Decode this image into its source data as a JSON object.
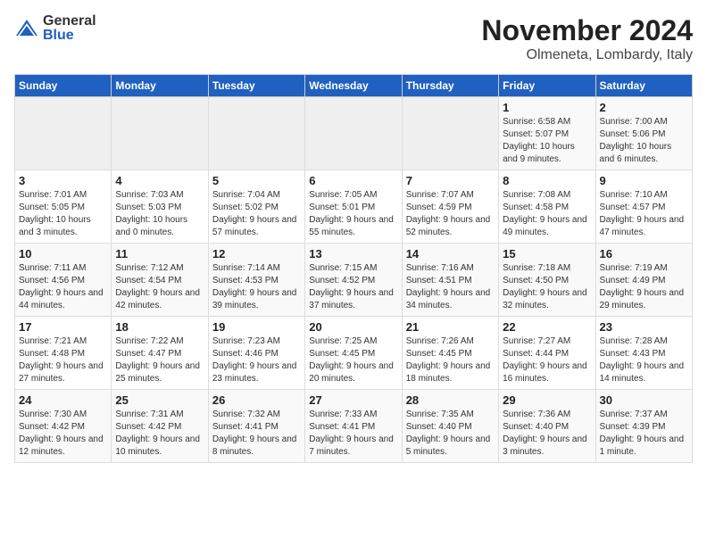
{
  "logo": {
    "general": "General",
    "blue": "Blue"
  },
  "title": "November 2024",
  "subtitle": "Olmeneta, Lombardy, Italy",
  "days_header": [
    "Sunday",
    "Monday",
    "Tuesday",
    "Wednesday",
    "Thursday",
    "Friday",
    "Saturday"
  ],
  "weeks": [
    [
      {
        "day": "",
        "info": ""
      },
      {
        "day": "",
        "info": ""
      },
      {
        "day": "",
        "info": ""
      },
      {
        "day": "",
        "info": ""
      },
      {
        "day": "",
        "info": ""
      },
      {
        "day": "1",
        "info": "Sunrise: 6:58 AM\nSunset: 5:07 PM\nDaylight: 10 hours and 9 minutes."
      },
      {
        "day": "2",
        "info": "Sunrise: 7:00 AM\nSunset: 5:06 PM\nDaylight: 10 hours and 6 minutes."
      }
    ],
    [
      {
        "day": "3",
        "info": "Sunrise: 7:01 AM\nSunset: 5:05 PM\nDaylight: 10 hours and 3 minutes."
      },
      {
        "day": "4",
        "info": "Sunrise: 7:03 AM\nSunset: 5:03 PM\nDaylight: 10 hours and 0 minutes."
      },
      {
        "day": "5",
        "info": "Sunrise: 7:04 AM\nSunset: 5:02 PM\nDaylight: 9 hours and 57 minutes."
      },
      {
        "day": "6",
        "info": "Sunrise: 7:05 AM\nSunset: 5:01 PM\nDaylight: 9 hours and 55 minutes."
      },
      {
        "day": "7",
        "info": "Sunrise: 7:07 AM\nSunset: 4:59 PM\nDaylight: 9 hours and 52 minutes."
      },
      {
        "day": "8",
        "info": "Sunrise: 7:08 AM\nSunset: 4:58 PM\nDaylight: 9 hours and 49 minutes."
      },
      {
        "day": "9",
        "info": "Sunrise: 7:10 AM\nSunset: 4:57 PM\nDaylight: 9 hours and 47 minutes."
      }
    ],
    [
      {
        "day": "10",
        "info": "Sunrise: 7:11 AM\nSunset: 4:56 PM\nDaylight: 9 hours and 44 minutes."
      },
      {
        "day": "11",
        "info": "Sunrise: 7:12 AM\nSunset: 4:54 PM\nDaylight: 9 hours and 42 minutes."
      },
      {
        "day": "12",
        "info": "Sunrise: 7:14 AM\nSunset: 4:53 PM\nDaylight: 9 hours and 39 minutes."
      },
      {
        "day": "13",
        "info": "Sunrise: 7:15 AM\nSunset: 4:52 PM\nDaylight: 9 hours and 37 minutes."
      },
      {
        "day": "14",
        "info": "Sunrise: 7:16 AM\nSunset: 4:51 PM\nDaylight: 9 hours and 34 minutes."
      },
      {
        "day": "15",
        "info": "Sunrise: 7:18 AM\nSunset: 4:50 PM\nDaylight: 9 hours and 32 minutes."
      },
      {
        "day": "16",
        "info": "Sunrise: 7:19 AM\nSunset: 4:49 PM\nDaylight: 9 hours and 29 minutes."
      }
    ],
    [
      {
        "day": "17",
        "info": "Sunrise: 7:21 AM\nSunset: 4:48 PM\nDaylight: 9 hours and 27 minutes."
      },
      {
        "day": "18",
        "info": "Sunrise: 7:22 AM\nSunset: 4:47 PM\nDaylight: 9 hours and 25 minutes."
      },
      {
        "day": "19",
        "info": "Sunrise: 7:23 AM\nSunset: 4:46 PM\nDaylight: 9 hours and 23 minutes."
      },
      {
        "day": "20",
        "info": "Sunrise: 7:25 AM\nSunset: 4:45 PM\nDaylight: 9 hours and 20 minutes."
      },
      {
        "day": "21",
        "info": "Sunrise: 7:26 AM\nSunset: 4:45 PM\nDaylight: 9 hours and 18 minutes."
      },
      {
        "day": "22",
        "info": "Sunrise: 7:27 AM\nSunset: 4:44 PM\nDaylight: 9 hours and 16 minutes."
      },
      {
        "day": "23",
        "info": "Sunrise: 7:28 AM\nSunset: 4:43 PM\nDaylight: 9 hours and 14 minutes."
      }
    ],
    [
      {
        "day": "24",
        "info": "Sunrise: 7:30 AM\nSunset: 4:42 PM\nDaylight: 9 hours and 12 minutes."
      },
      {
        "day": "25",
        "info": "Sunrise: 7:31 AM\nSunset: 4:42 PM\nDaylight: 9 hours and 10 minutes."
      },
      {
        "day": "26",
        "info": "Sunrise: 7:32 AM\nSunset: 4:41 PM\nDaylight: 9 hours and 8 minutes."
      },
      {
        "day": "27",
        "info": "Sunrise: 7:33 AM\nSunset: 4:41 PM\nDaylight: 9 hours and 7 minutes."
      },
      {
        "day": "28",
        "info": "Sunrise: 7:35 AM\nSunset: 4:40 PM\nDaylight: 9 hours and 5 minutes."
      },
      {
        "day": "29",
        "info": "Sunrise: 7:36 AM\nSunset: 4:40 PM\nDaylight: 9 hours and 3 minutes."
      },
      {
        "day": "30",
        "info": "Sunrise: 7:37 AM\nSunset: 4:39 PM\nDaylight: 9 hours and 1 minute."
      }
    ]
  ]
}
